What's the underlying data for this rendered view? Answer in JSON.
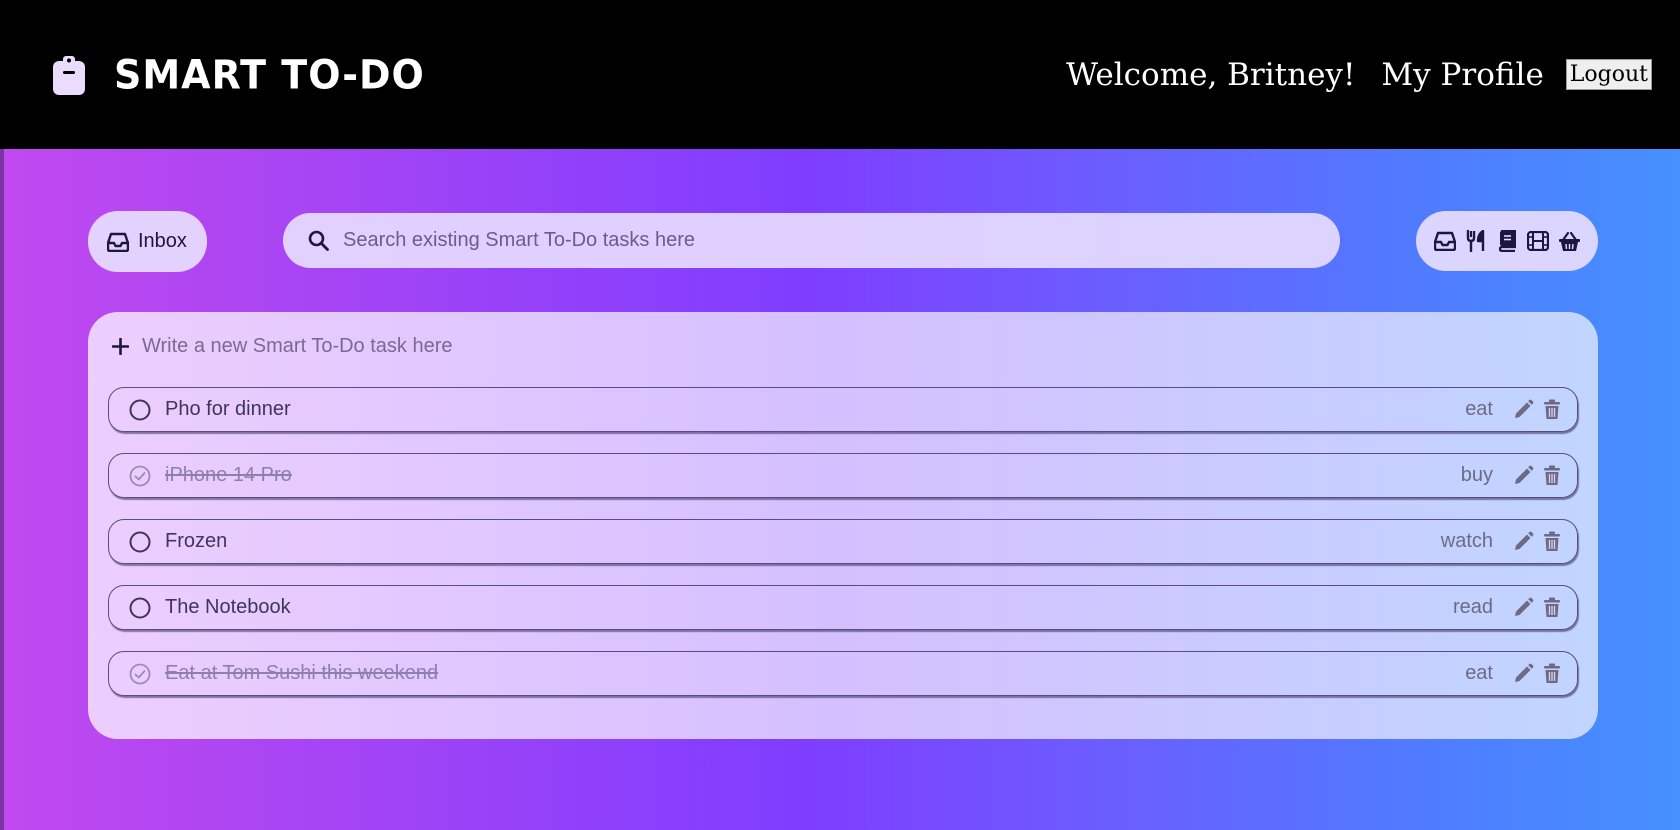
{
  "header": {
    "brand_title": "SMART TO-DO",
    "brand_icon": "clipboard-icon",
    "welcome_text": "Welcome, Britney!",
    "profile_link": "My Profile",
    "logout_label": "Logout"
  },
  "toolbar": {
    "inbox_label": "Inbox",
    "search_placeholder": "Search existing Smart To-Do tasks here",
    "filters": [
      "inbox-icon",
      "utensils-icon",
      "book-icon",
      "film-icon",
      "basket-icon"
    ]
  },
  "new_task": {
    "placeholder": "Write a new Smart To-Do task here"
  },
  "tasks": [
    {
      "title": "Pho for dinner",
      "category": "eat",
      "done": false
    },
    {
      "title": "iPhone 14 Pro",
      "category": "buy",
      "done": true
    },
    {
      "title": "Frozen",
      "category": "watch",
      "done": false
    },
    {
      "title": "The Notebook",
      "category": "read",
      "done": false
    },
    {
      "title": "Eat at Tom Sushi this weekend",
      "category": "eat",
      "done": true
    }
  ],
  "colors": {
    "topbar": "#000000",
    "text_dark": "#1d1640",
    "task_text": "#3f3658",
    "done_text": "#8d80ad",
    "action_icon": "#6e6a86"
  }
}
